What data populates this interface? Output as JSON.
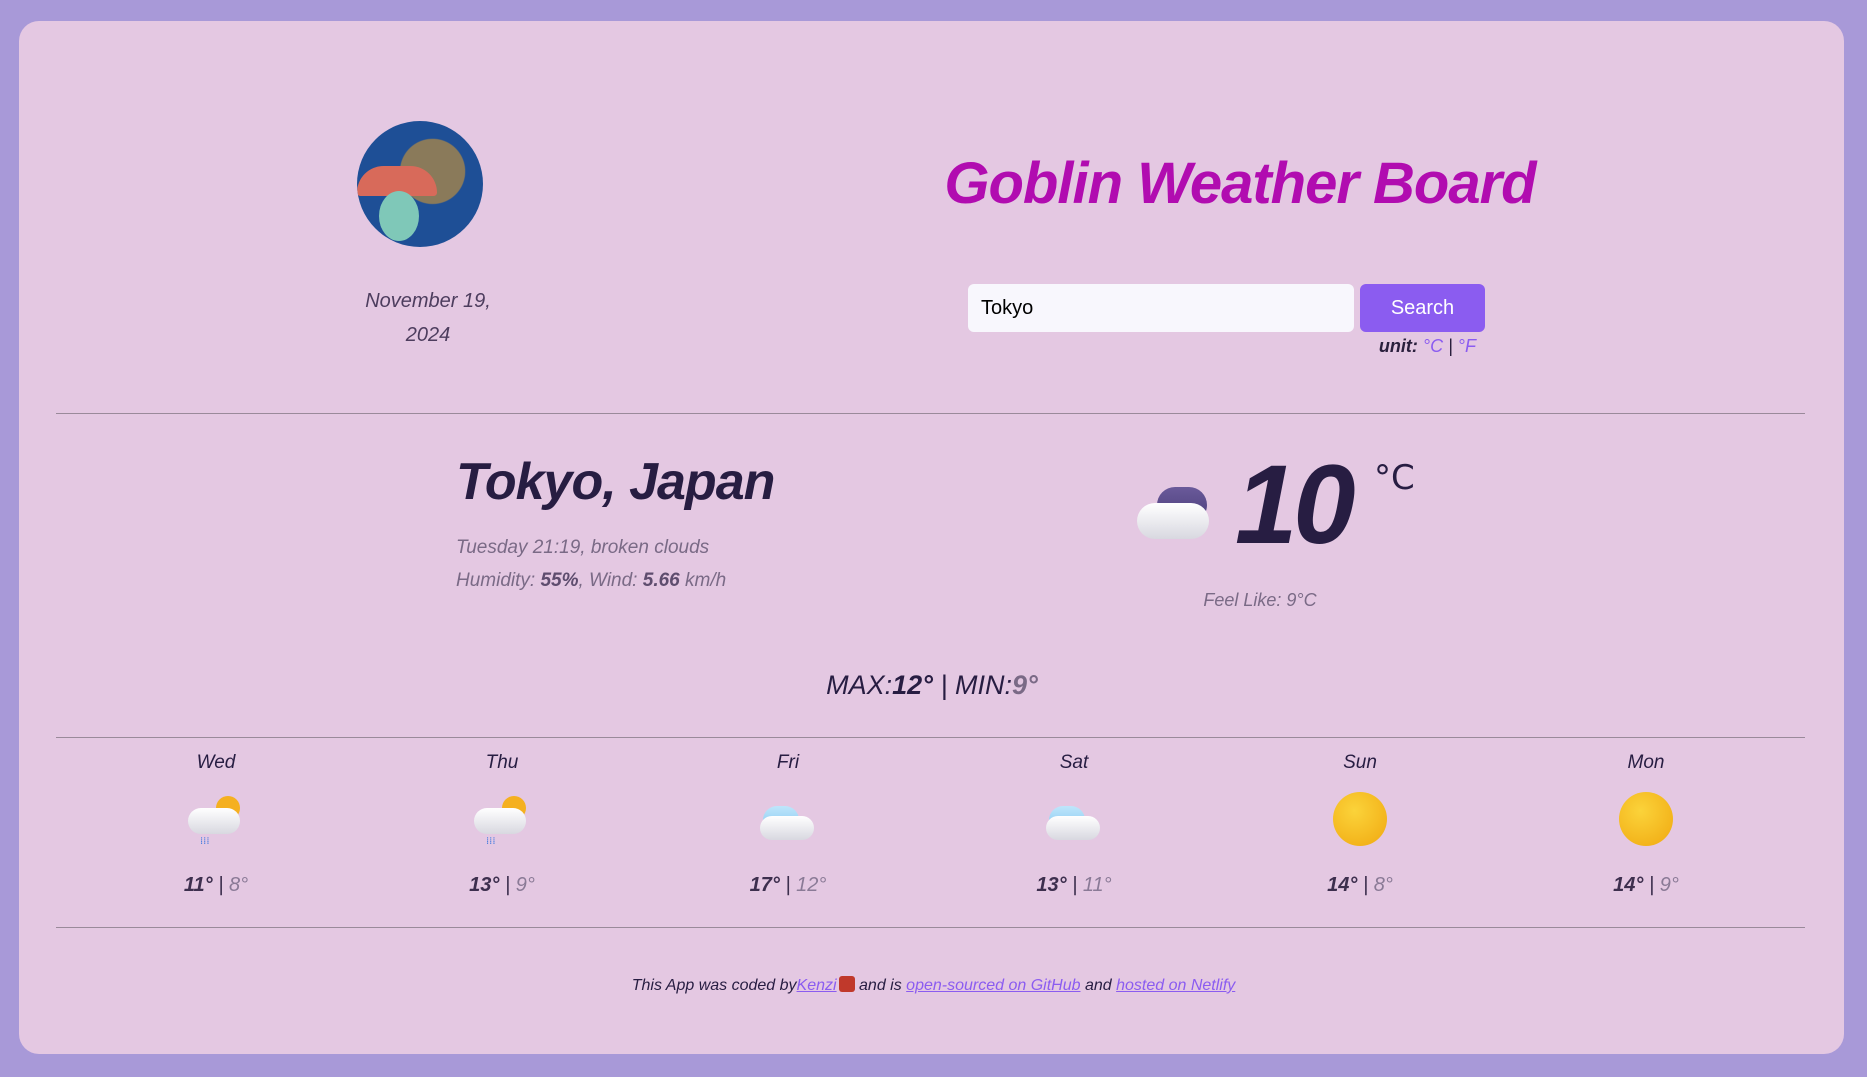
{
  "header": {
    "title": "Goblin Weather Board",
    "date_line1": "November 19,",
    "date_line2": "2024"
  },
  "search": {
    "value": "Tokyo",
    "button_label": "Search",
    "unit_label": "unit:",
    "unit_c": "°C",
    "unit_sep": "|",
    "unit_f": "°F"
  },
  "current": {
    "city": "Tokyo, Japan",
    "description": "Tuesday 21:19, broken clouds",
    "humidity_label": "Humidity:",
    "humidity": "55%",
    "wind_label": ", Wind:",
    "wind": "5.66",
    "wind_unit": "km/h",
    "temperature": "10",
    "unit": "°C",
    "icon": "broken-clouds-icon",
    "feels_like": "Feel Like: 9°C",
    "max_label": "MAX:",
    "max": "12°",
    "sep": "|",
    "min_label": "MIN:",
    "min": "9°"
  },
  "forecast": [
    {
      "day": "Wed",
      "icon": "rain-sun-icon",
      "high": "11°",
      "low": "8°"
    },
    {
      "day": "Thu",
      "icon": "rain-sun-icon",
      "high": "13°",
      "low": "9°"
    },
    {
      "day": "Fri",
      "icon": "cloud-icon",
      "high": "17°",
      "low": "12°"
    },
    {
      "day": "Sat",
      "icon": "cloud-icon",
      "high": "13°",
      "low": "11°"
    },
    {
      "day": "Sun",
      "icon": "sun-icon",
      "high": "14°",
      "low": "8°"
    },
    {
      "day": "Mon",
      "icon": "sun-icon",
      "high": "14°",
      "low": "9°"
    }
  ],
  "footer": {
    "text1": "This App was coded by",
    "author": "Kenzi",
    "text2": " and is ",
    "github": "open-sourced on GitHub",
    "text3": " and ",
    "netlify": "hosted on Netlify"
  },
  "colors": {
    "background": "#a899d8",
    "card": "#e4c8e2",
    "title": "#b10cb0",
    "accent": "#8b5cf0",
    "text": "#271d42"
  }
}
